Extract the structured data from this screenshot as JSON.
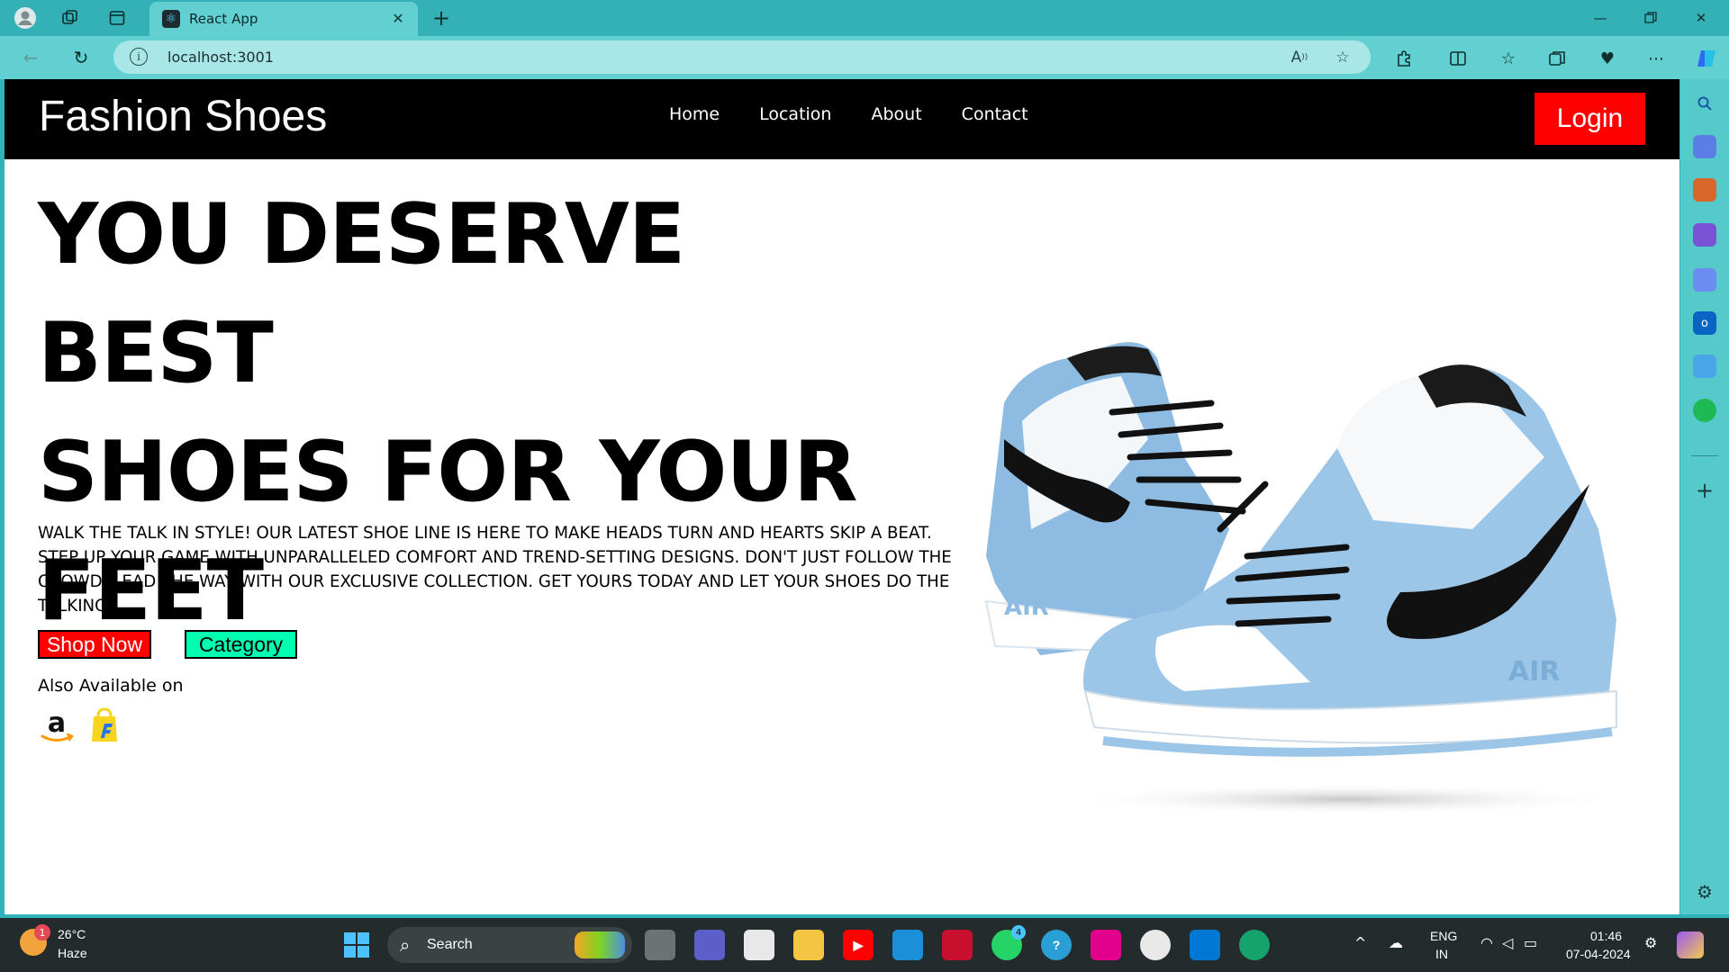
{
  "browser": {
    "tab_title": "React App",
    "address": "localhost:3001"
  },
  "site": {
    "brand": "Fashion Shoes",
    "nav": [
      "Home",
      "Location",
      "About",
      "Contact"
    ],
    "login_label": "Login"
  },
  "hero": {
    "title_lines": [
      "YOU DESERVE BEST",
      "SHOES FOR YOUR",
      "FEET"
    ],
    "description": "WALK THE TALK IN STYLE! OUR LATEST SHOE LINE IS HERE TO MAKE HEADS TURN AND HEARTS SKIP A BEAT. STEP UP YOUR GAME WITH UNPARALLELED COMFORT AND TREND-SETTING DESIGNS. DON'T JUST FOLLOW THE CROWD, LEAD THE WAY WITH OUR EXCLUSIVE COLLECTION. GET YOURS TODAY AND LET YOUR SHOES DO THE TALKING",
    "shop_label": "Shop Now",
    "category_label": "Category",
    "also_available": "Also Available on",
    "shoe_brand_text": "AIR"
  },
  "colors": {
    "nav_bg": "#000000",
    "login_bg": "#ff0000",
    "shop_bg": "#ff0000",
    "category_bg": "#00ffb0",
    "browser_frame": "#34b1b6"
  },
  "taskbar": {
    "weather_temp": "26°C",
    "weather_condition": "Haze",
    "weather_badge": "1",
    "search_label": "Search",
    "whatsapp_badge": "4",
    "lang_line1": "ENG",
    "lang_line2": "IN",
    "time": "01:46",
    "date": "07-04-2024"
  }
}
